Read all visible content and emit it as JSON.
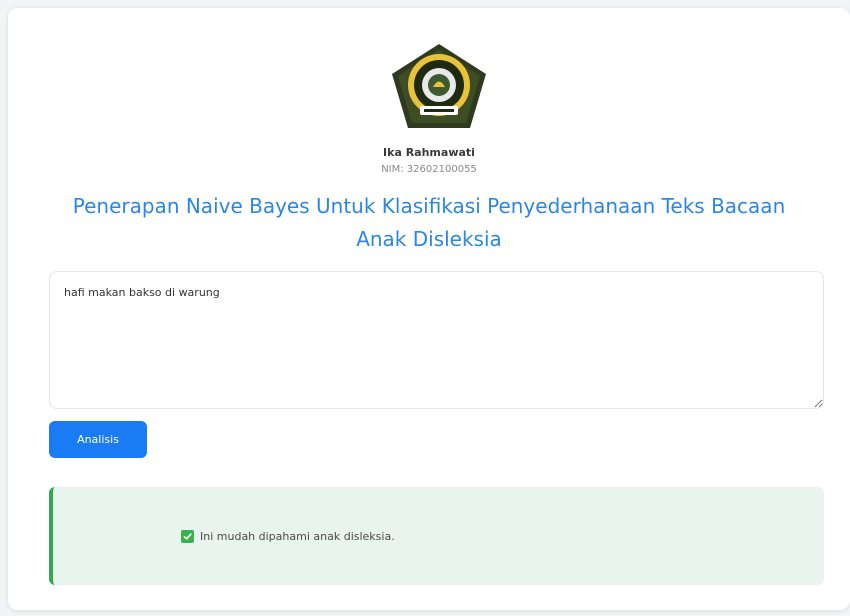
{
  "header": {
    "author_name": "Ika Rahmawati",
    "nim": "NIM: 32602100055",
    "title": "Penerapan Naive Bayes Untuk Klasifikasi Penyederhanaan Teks Bacaan Anak Disleksia"
  },
  "form": {
    "input_value": "hafi makan bakso di warung",
    "submit_label": "Analisis"
  },
  "result": {
    "icon": "check-icon",
    "message": "Ini mudah dipahami anak disleksia."
  },
  "colors": {
    "accent": "#1a7cf5",
    "title": "#2b86e8",
    "success": "#33a852",
    "success_bg": "#e9f4ee"
  }
}
